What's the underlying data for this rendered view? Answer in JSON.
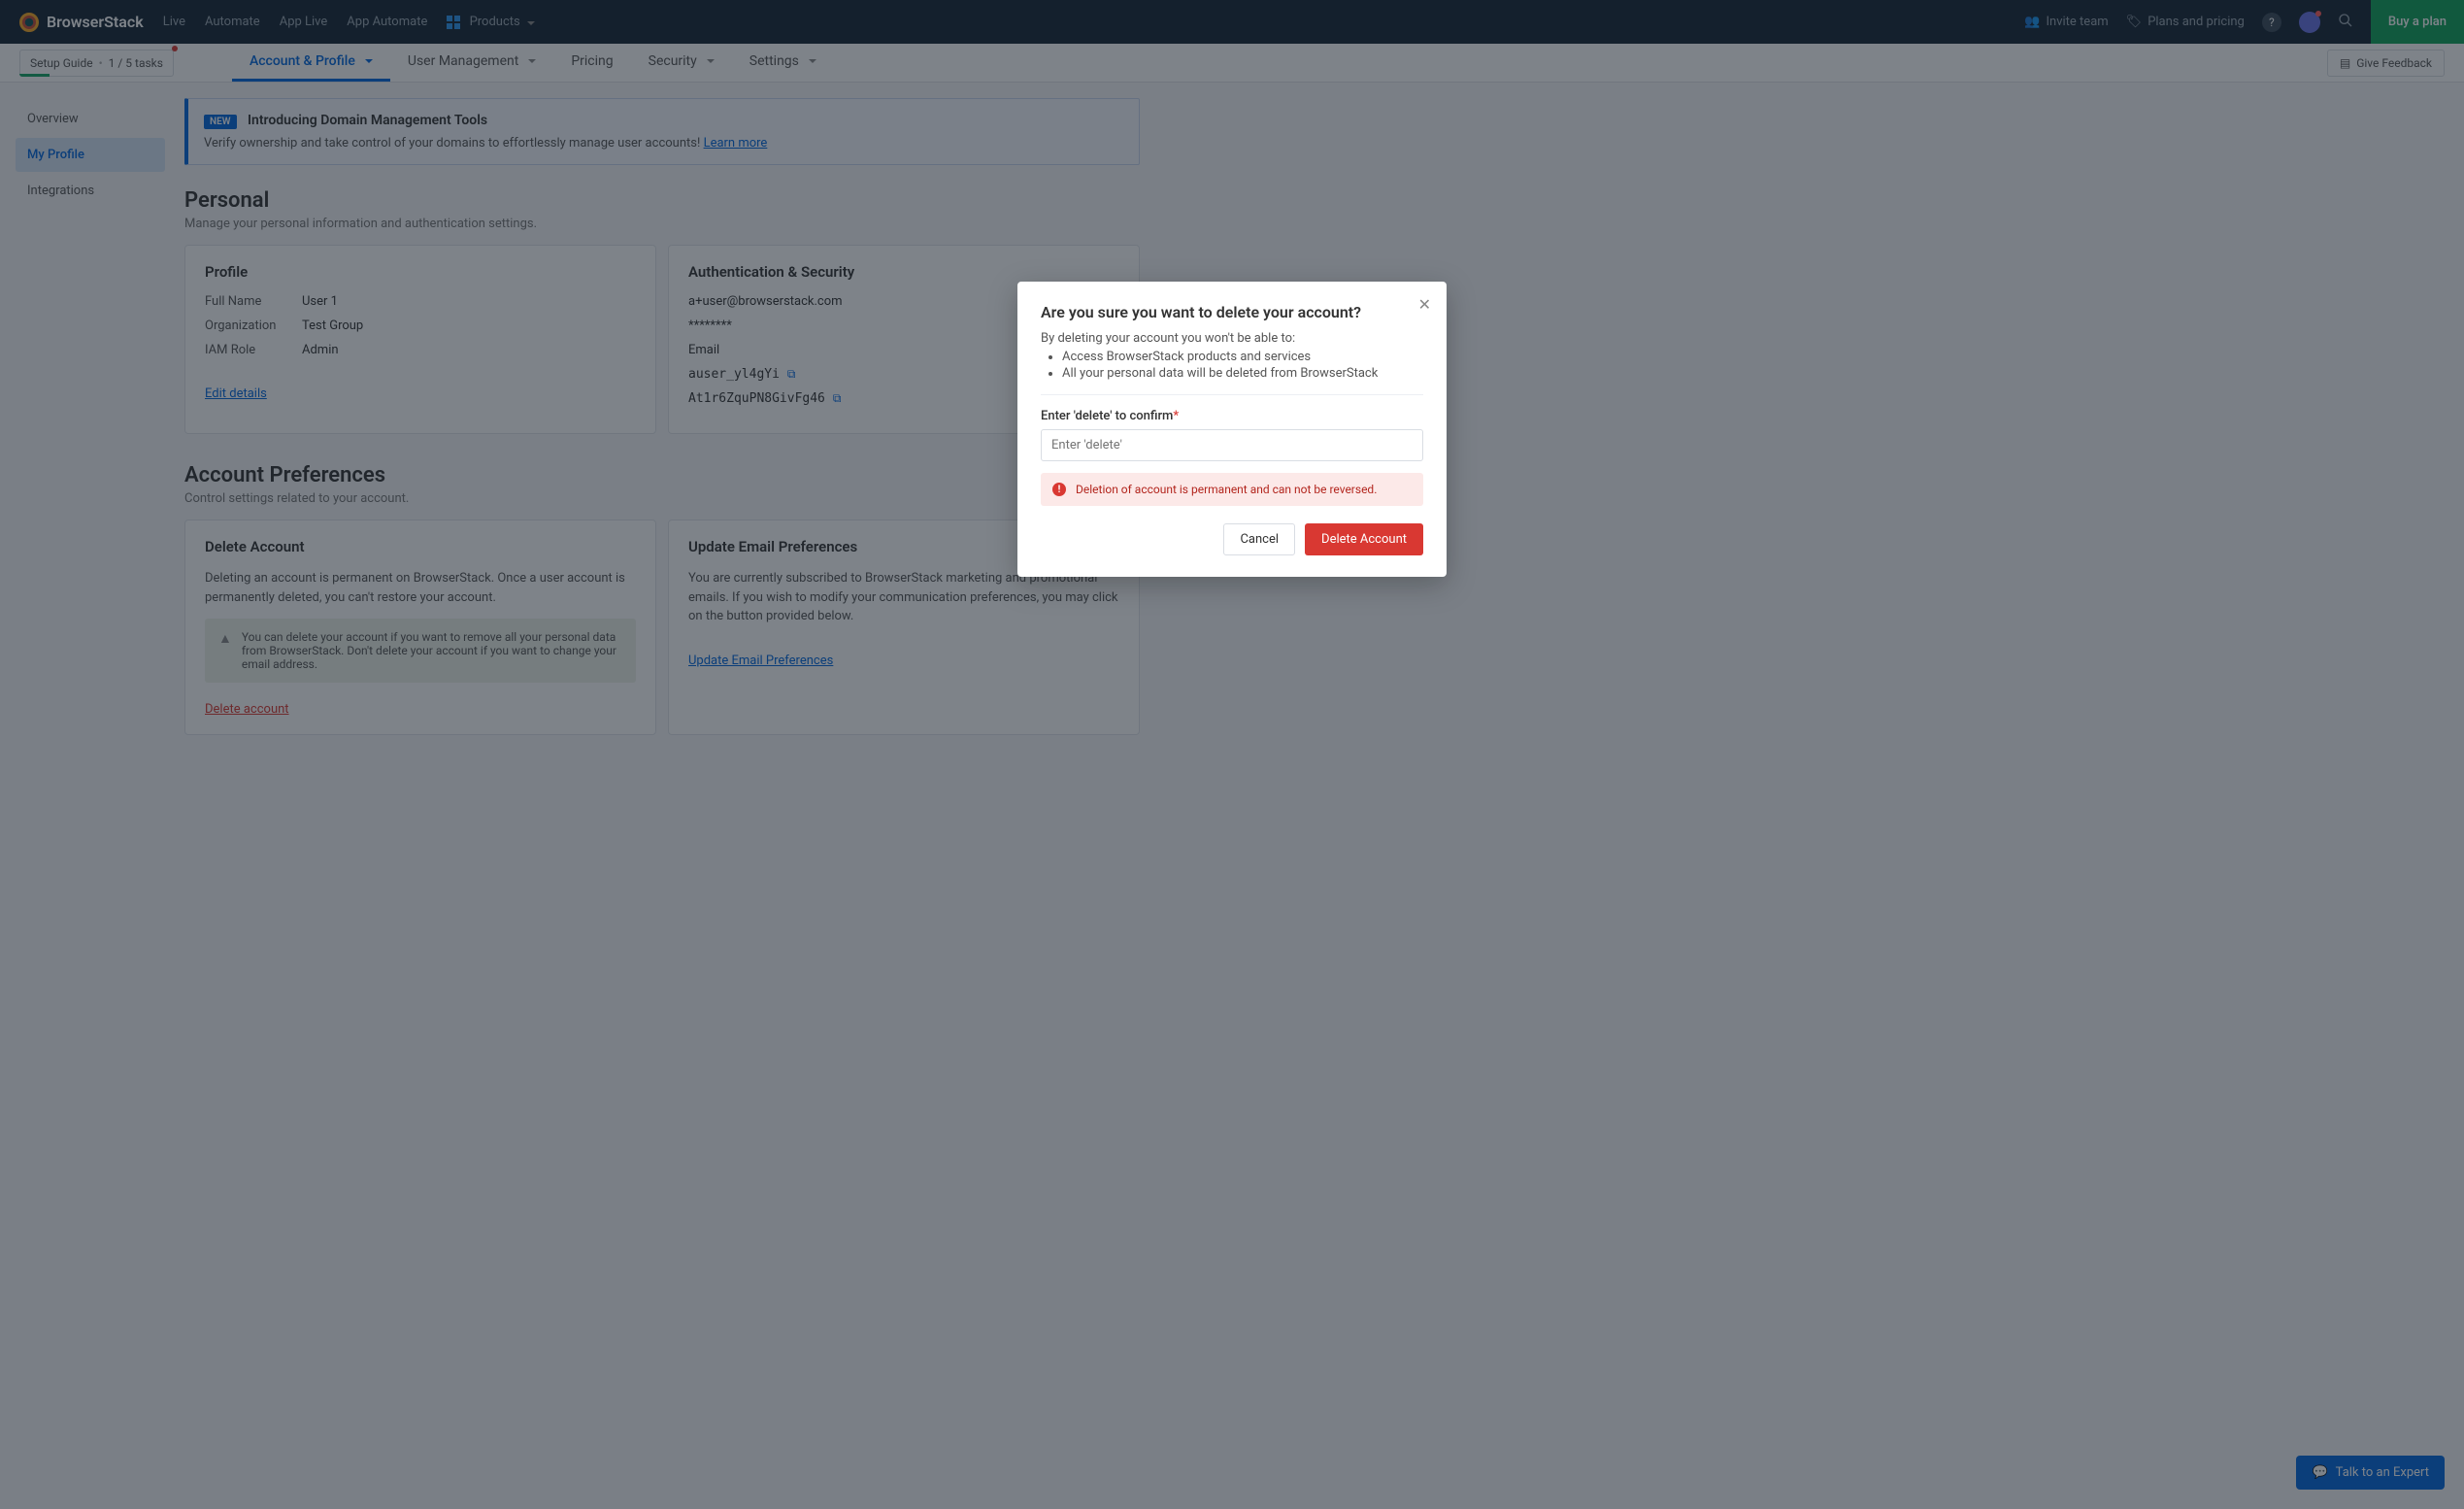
{
  "topbar": {
    "logo_text": "BrowserStack",
    "nav": [
      "Live",
      "Automate",
      "App Live",
      "App Automate"
    ],
    "products_label": "Products",
    "invite_team": "Invite team",
    "plans_pricing": "Plans and pricing",
    "buy_plan": "Buy a plan"
  },
  "subnav": {
    "setup_guide": "Setup Guide",
    "setup_progress": "1 / 5 tasks",
    "tabs": [
      "Account & Profile",
      "User Management",
      "Pricing",
      "Security",
      "Settings"
    ],
    "feedback": "Give Feedback"
  },
  "sidenav": {
    "items": [
      "Overview",
      "My Profile",
      "Integrations"
    ]
  },
  "banner": {
    "chip": "NEW",
    "title": "Introducing Domain Management Tools",
    "text": "Verify ownership and take control of your domains to effortlessly manage user accounts!",
    "learn_more": "Learn more"
  },
  "personal": {
    "title": "Personal",
    "subtitle": "Manage your personal information and authentication settings.",
    "profile": {
      "heading": "Profile",
      "full_name_label": "Full Name",
      "full_name": "User 1",
      "org_label": "Organization",
      "org": "Test Group",
      "role_label": "IAM Role",
      "role": "Admin",
      "edit": "Edit details"
    },
    "auth": {
      "heading": "Authentication & Security",
      "email_suffix": "a+user@browserstack.com",
      "password_mask": "********",
      "method": "Email",
      "username": "auser_yl4gYi",
      "key": "At1r6ZquPN8GivFg46"
    }
  },
  "preferences": {
    "title": "Account Preferences",
    "subtitle": "Control settings related to your account.",
    "delete": {
      "heading": "Delete Account",
      "text": "Deleting an account is permanent on BrowserStack. Once a user account is permanently deleted, you can't restore your account.",
      "warn": "You can delete your account if you want to remove all your personal data from BrowserStack. Don't delete your account if you want to change your email address.",
      "action": "Delete account"
    },
    "email_pref": {
      "heading": "Update Email Preferences",
      "text": "You are currently subscribed to BrowserStack marketing and promotional emails. If you wish to modify your communication preferences, you may click on the button provided below.",
      "action": "Update Email Preferences"
    }
  },
  "modal": {
    "title": "Are you sure you want to delete your account?",
    "intro": "By deleting your account you won't be able to:",
    "bullets": [
      "Access BrowserStack products and services",
      "All your personal data will be deleted from BrowserStack"
    ],
    "confirm_label": "Enter 'delete' to confirm",
    "placeholder": "Enter 'delete'",
    "alert": "Deletion of account is permanent and can not be reversed.",
    "cancel": "Cancel",
    "delete": "Delete Account"
  },
  "chat": {
    "label": "Talk to an Expert"
  }
}
